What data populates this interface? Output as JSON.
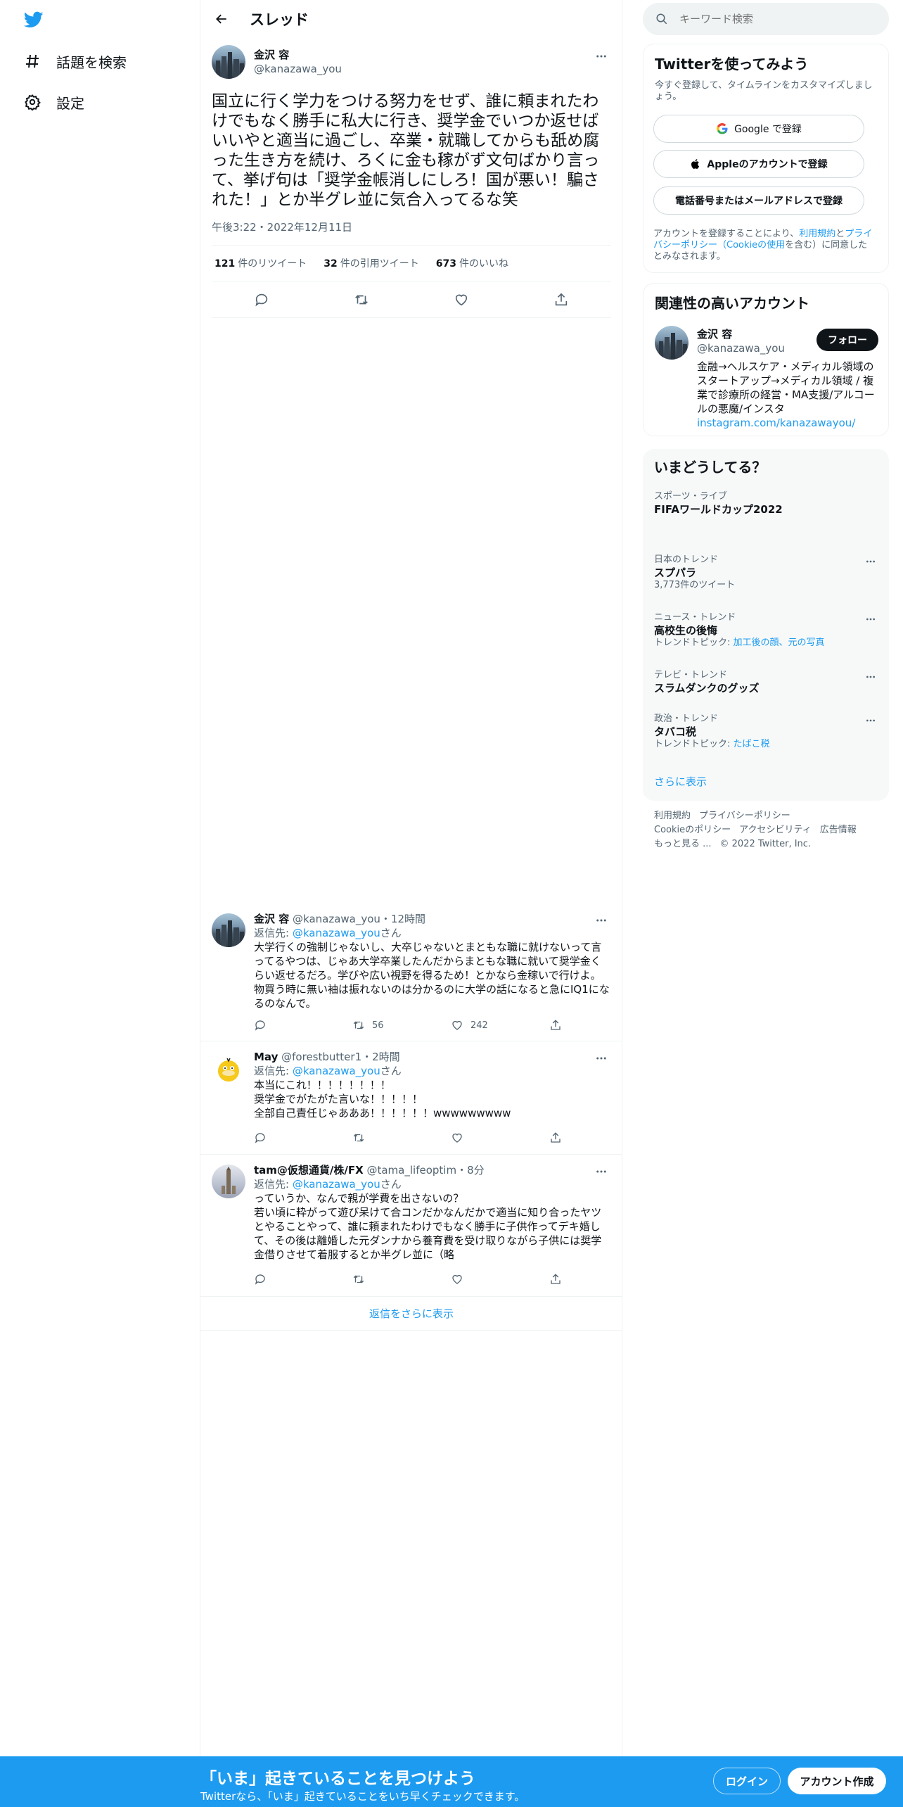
{
  "nav": {
    "items": [
      {
        "label": "話題を検索",
        "icon": "hashtag-icon"
      },
      {
        "label": "設定",
        "icon": "gear-icon"
      }
    ]
  },
  "header": {
    "title": "スレッド"
  },
  "main_tweet": {
    "name": "金沢 容",
    "handle": "@kanazawa_you",
    "text": "国立に行く学力をつける努力をせず、誰に頼まれたわけでもなく勝手に私大に行き、奨学金でいつか返せばいいやと適当に過ごし、卒業・就職してからも舐め腐った生き方を続け、ろくに金も稼がず文句ばかり言って、挙げ句は「奨学金帳消しにしろ！国が悪い！騙された！」とか半グレ並に気合入ってるな笑",
    "time": "午後3:22・2022年12月11日",
    "stats": [
      {
        "count": "121",
        "label": "件のリツイート"
      },
      {
        "count": "32",
        "label": "件の引用ツイート"
      },
      {
        "count": "673",
        "label": "件のいいね"
      }
    ]
  },
  "replies": [
    {
      "name": "金沢 容",
      "handle": "@kanazawa_you",
      "time": "・12時間",
      "reply_prefix": "返信先: ",
      "reply_to": "@kanazawa_you",
      "reply_suffix": "さん",
      "text": "大学行くの強制じゃないし、大卒じゃないとまともな職に就けないって言ってるやつは、じゃあ大学卒業したんだからまともな職に就いて奨学金くらい返せるだろ。学びや広い視野を得るため！とかなら金稼いで行けよ。物買う時に無い袖は振れないのは分かるのに大学の話になると急にIQ1になるのなんで。",
      "retweets": "56",
      "likes": "242"
    },
    {
      "name": "May",
      "handle": "@forestbutter1",
      "time": "・2時間",
      "reply_prefix": "返信先: ",
      "reply_to": "@kanazawa_you",
      "reply_suffix": "さん",
      "text": "本当にこれ！！！！！！！！\n奨学金でがたがた言いな！！！！！\n全部自己責任じゃあああ！！！！！！wwwwwwwww",
      "retweets": "",
      "likes": ""
    },
    {
      "name": "tam@仮想通貨/株/FX",
      "handle": "@tama_lifeoptim",
      "time": "・8分",
      "reply_prefix": "返信先: ",
      "reply_to": "@kanazawa_you",
      "reply_suffix": "さん",
      "text": "っていうか、なんで親が学費を出さないの？\n若い頃に粋がって遊び呆けて合コンだかなんだかで適当に知り合ったヤツとやることやって、誰に頼まれたわけでもなく勝手に子供作ってデキ婚して、その後は離婚した元ダンナから養育費を受け取りながら子供には奨学金借りさせて着服するとか半グレ並に（略",
      "retweets": "",
      "likes": ""
    }
  ],
  "show_more_replies": "返信をさらに表示",
  "search": {
    "placeholder": "キーワード検索"
  },
  "signup_card": {
    "title": "Twitterを使ってみよう",
    "subtitle": "今すぐ登録して、タイムラインをカスタマイズしましょう。",
    "google": "Google で登録",
    "apple": "Appleのアカウントで登録",
    "phone": "電話番号またはメールアドレスで登録",
    "terms_pre": "アカウントを登録することにより、",
    "terms_link1": "利用規約",
    "terms_mid": "と",
    "terms_link2": "プライバシーポリシー（Cookieの使用",
    "terms_post": "を含む）に同意したとみなされます。"
  },
  "relevant": {
    "title": "関連性の高いアカウント",
    "name": "金沢 容",
    "handle": "@kanazawa_you",
    "follow": "フォロー",
    "bio": "金融→ヘルスケア・メディカル領域のスタートアップ→メディカル領域 / 複業で診療所の経営・MA支援/アルコールの悪魔/インスタ",
    "link": "instagram.com/kanazawayou/"
  },
  "trends": {
    "title": "いまどうしてる？",
    "items": [
      {
        "context": "スポーツ・ライブ",
        "name": "FIFAワールドカップ2022",
        "meta": "",
        "meta_link": ""
      },
      {
        "context": "日本のトレンド",
        "name": "スプパラ",
        "meta": "3,773件のツイート",
        "meta_link": ""
      },
      {
        "context": "ニュース・トレンド",
        "name": "高校生の後悔",
        "meta": "トレンドトピック: ",
        "meta_link": "加工後の顔、元の写真"
      },
      {
        "context": "テレビ・トレンド",
        "name": "スラムダンクのグッズ",
        "meta": "",
        "meta_link": ""
      },
      {
        "context": "政治・トレンド",
        "name": "タバコ税",
        "meta": "トレンドトピック: ",
        "meta_link": "たばこ税"
      }
    ],
    "show_more": "さらに表示"
  },
  "footer": {
    "links": [
      "利用規約",
      "プライバシーポリシー",
      "Cookieのポリシー",
      "アクセシビリティ",
      "広告情報",
      "もっと見る ...",
      "© 2022 Twitter, Inc."
    ]
  },
  "bottom_bar": {
    "title": "「いま」起きていることを見つけよう",
    "subtitle": "Twitterなら、「いま」起きていることをいち早くチェックできます。",
    "login": "ログイン",
    "signup": "アカウント作成"
  },
  "colors": {
    "accent": "#1d9bf0",
    "text": "#0f1419",
    "muted": "#536471",
    "border": "#eff3f4"
  }
}
